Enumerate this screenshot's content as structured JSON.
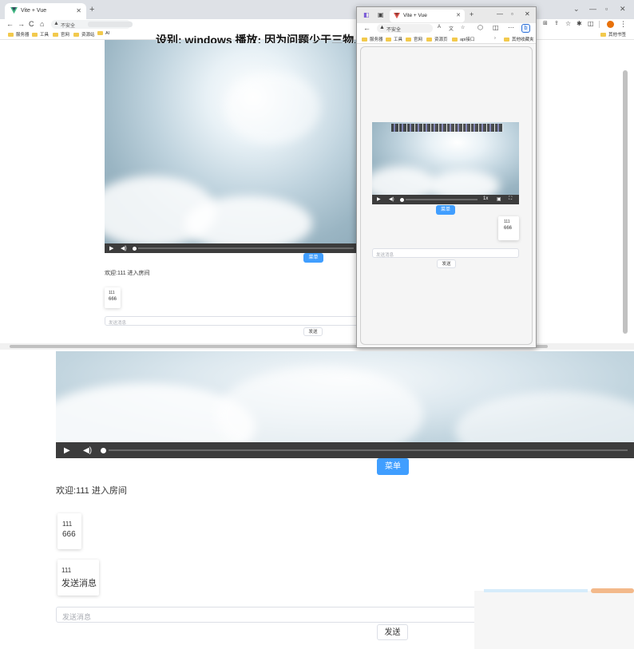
{
  "browser": {
    "tab_title": "Vite + Vue",
    "address": "不安全",
    "bookmarks": [
      "服务器",
      "工具",
      "官网",
      "资源站",
      "AI"
    ],
    "other_bookmarks": "其他书签"
  },
  "edge_browser": {
    "tab_title": "Vite + Vue",
    "address": "不安全",
    "bookmarks": [
      "服务器",
      "工具",
      "官网",
      "资源页",
      "api接口"
    ],
    "other_bookmarks": "其他收藏夹",
    "video": {
      "speed": "1x"
    },
    "menu_label": "菜单",
    "message": {
      "user": "111",
      "text": "666"
    },
    "input_placeholder": "发送消息",
    "send_label": "发送"
  },
  "page": {
    "video_caption": "设别: windows 播放: 因为问题少于三物...",
    "menu_label": "菜单",
    "welcome": "欢迎:111 进入房间",
    "messages": [
      {
        "user": "111",
        "text": "666"
      },
      {
        "user": "111",
        "text": "发送消息"
      }
    ],
    "input_placeholder": "发送消息",
    "send_label": "发送"
  },
  "colors": {
    "accent": "#409eff",
    "video_bar": "#3c3c3c"
  }
}
